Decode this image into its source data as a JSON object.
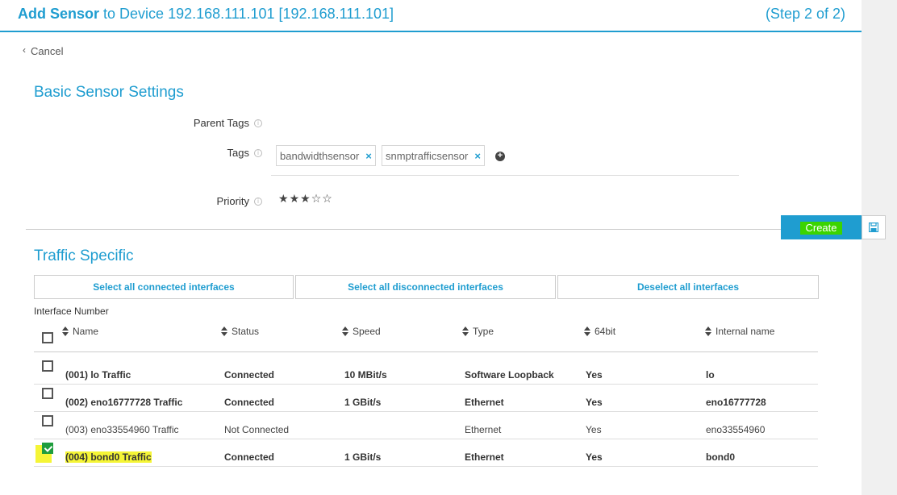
{
  "header": {
    "title_bold": "Add Sensor",
    "title_rest": "to Device 192.168.111.101 [192.168.111.101]",
    "step": "(Step 2 of 2)"
  },
  "cancel_label": "Cancel",
  "basic_settings": {
    "title": "Basic Sensor Settings",
    "parent_tags_label": "Parent Tags",
    "tags_label": "Tags",
    "tags": [
      "bandwidthsensor",
      "snmptrafficsensor"
    ],
    "priority_label": "Priority",
    "priority_stars": 3,
    "priority_max": 5
  },
  "create_label": "Create",
  "traffic": {
    "title": "Traffic Specific",
    "buttons": {
      "select_connected": "Select all connected interfaces",
      "select_disconnected": "Select all disconnected interfaces",
      "deselect_all": "Deselect all interfaces"
    },
    "interface_number_label": "Interface Number",
    "columns": [
      "Name",
      "Status",
      "Speed",
      "Type",
      "64bit",
      "Internal name"
    ],
    "rows": [
      {
        "checked": false,
        "bold": true,
        "name": "(001) lo Traffic",
        "status": "Connected",
        "speed": "10 MBit/s",
        "type": "Software Loopback",
        "bit64": "Yes",
        "internal": "lo"
      },
      {
        "checked": false,
        "bold": true,
        "name": "(002) eno16777728 Traffic",
        "status": "Connected",
        "speed": "1 GBit/s",
        "type": "Ethernet",
        "bit64": "Yes",
        "internal": "eno16777728"
      },
      {
        "checked": false,
        "bold": false,
        "name": "(003) eno33554960 Traffic",
        "status": "Not Connected",
        "speed": "",
        "type": "Ethernet",
        "bit64": "Yes",
        "internal": "eno33554960"
      },
      {
        "checked": true,
        "bold": true,
        "name": "(004) bond0 Traffic",
        "status": "Connected",
        "speed": "1 GBit/s",
        "type": "Ethernet",
        "bit64": "Yes",
        "internal": "bond0"
      }
    ]
  },
  "colors": {
    "accent": "#1f9dd0",
    "highlight": "#f5f536",
    "create_highlight": "#3bd400",
    "checkbox_checked": "#1f9d3d"
  },
  "icons": {
    "cancel": "chevron-left-icon",
    "info": "info-icon",
    "tag_remove": "close-icon",
    "add_tag": "plus-circle-icon",
    "star": "star-icon",
    "save": "floppy-disk-icon",
    "sort": "sort-icon"
  }
}
